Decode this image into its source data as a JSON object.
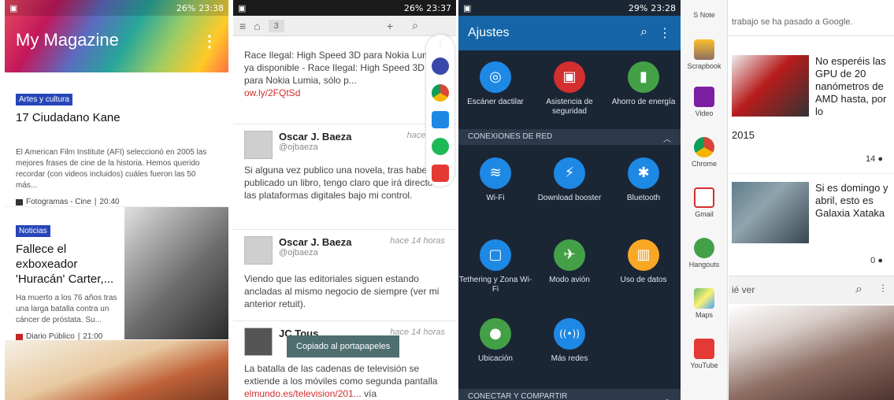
{
  "p1": {
    "statusbar": {
      "time": "23:38",
      "battery": "26%"
    },
    "title": "My Magazine",
    "cards": [
      {
        "tag": "Artes y cultura",
        "title": "17 Ciudadano Kane",
        "body": "El American Film Institute (AFI) seleccionó en 2005 las mejores frases de cine de la historia. Hemos querido recordar (con videos incluidos) cuáles fueron las 50 más...",
        "source": "Fotogramas - Cine",
        "time": "20:40"
      },
      {
        "tag": "Noticias",
        "title": "Fallece el exboxeador 'Huracán' Carter,...",
        "body": "Ha muerto a los 76 años tras una larga batalla contra un cáncer de próstata. Su...",
        "source": "Diario Público",
        "time": "21:00"
      }
    ]
  },
  "p2": {
    "statusbar": {
      "time": "23:37",
      "battery": "26%"
    },
    "tab_count": "3",
    "tweets": [
      {
        "text": "Race Ilegal: High Speed 3D para Nokia Lumia ya disponible - Race Ilegal: High Speed 3D para Nokia Lumia, sólo p...",
        "link": "ow.ly/2FQtSd"
      },
      {
        "name": "Oscar J. Baeza",
        "handle": "@ojbaeza",
        "time": "hace 14 h",
        "text": "Si alguna vez publico una novela, tras haber publicado un libro, tengo claro que irá directo a las plataformas digitales bajo mi control."
      },
      {
        "name": "Oscar J. Baeza",
        "handle": "@ojbaeza",
        "time": "hace 14 horas",
        "text": "Viendo que las editoriales siguen estando ancladas al mismo negocio de siempre (ver mi anterior retuit)."
      },
      {
        "name": "JC Tous",
        "handle": "",
        "time": "hace 14 horas",
        "text": "La batalla de las cadenas de televisión se extiende a los móviles como segunda pantalla",
        "link": "elmundo.es/television/201...",
        "suffix": "vía"
      }
    ],
    "toast": "Copiado al portapapeles"
  },
  "p3": {
    "statusbar": {
      "time": "23:28",
      "battery": "29%"
    },
    "title": "Ajustes",
    "row1": [
      {
        "label": "Escáner dactilar",
        "icon": "fingerprint-icon",
        "color": "#1e88e5",
        "glyph": "◎"
      },
      {
        "label": "Asistencia de seguridad",
        "icon": "alert-icon",
        "color": "#d32f2f",
        "glyph": "▣"
      },
      {
        "label": "Ahorro de energía",
        "icon": "battery-icon",
        "color": "#43a047",
        "glyph": "▮"
      }
    ],
    "section1": "CONEXIONES DE RED",
    "row2": [
      {
        "label": "Wi-Fi",
        "icon": "wifi-icon",
        "color": "#1e88e5",
        "glyph": "≋"
      },
      {
        "label": "Download booster",
        "icon": "booster-icon",
        "color": "#1e88e5",
        "glyph": "⚡"
      },
      {
        "label": "Bluetooth",
        "icon": "bluetooth-icon",
        "color": "#1e88e5",
        "glyph": "✱"
      }
    ],
    "row3": [
      {
        "label": "Tethering y Zona Wi-Fi",
        "icon": "tethering-icon",
        "color": "#1e88e5",
        "glyph": "▢"
      },
      {
        "label": "Modo avión",
        "icon": "airplane-icon",
        "color": "#43a047",
        "glyph": "✈"
      },
      {
        "label": "Uso de datos",
        "icon": "data-usage-icon",
        "color": "#f9a825",
        "glyph": "▥"
      }
    ],
    "row4": [
      {
        "label": "Ubicación",
        "icon": "location-icon",
        "color": "#43a047",
        "glyph": "●"
      },
      {
        "label": "Más redes",
        "icon": "more-networks-icon",
        "color": "#1e88e5",
        "glyph": "((•))"
      }
    ],
    "section2": "CONECTAR Y COMPARTIR"
  },
  "p4": {
    "apps": [
      "S Note",
      "Scrapbook",
      "Video",
      "Chrome",
      "Gmail",
      "Hangouts",
      "Maps",
      "YouTube"
    ]
  },
  "p5": {
    "topbar": "trabajo se ha pasado a Google.",
    "news": [
      {
        "text": "No esperéis las GPU de 20 nanómetros de AMD hasta, por lo",
        "extra": "2015",
        "count": "14"
      },
      {
        "text": "Si es domingo y abril, esto es Galaxia Xataka",
        "count": "0"
      }
    ],
    "search_label": "ié ver"
  }
}
